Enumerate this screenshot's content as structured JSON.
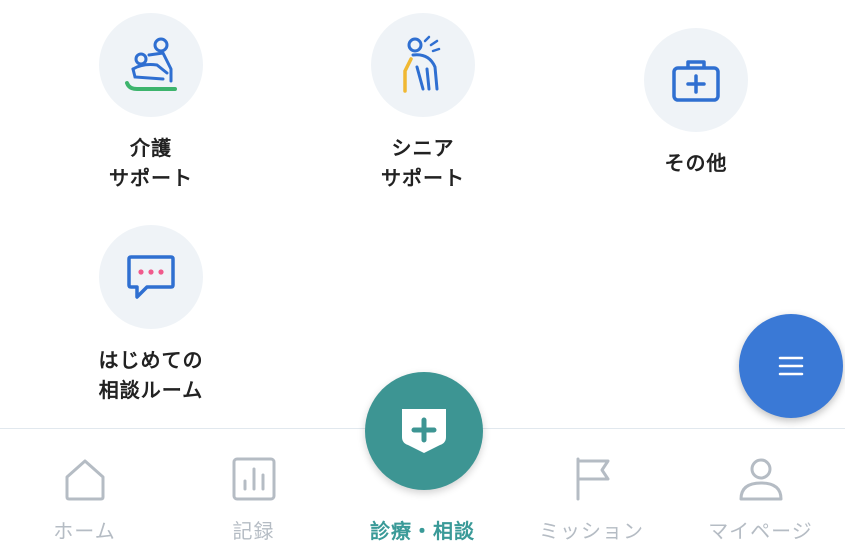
{
  "categories": [
    {
      "id": "care",
      "icon": "caregiving-icon",
      "label_lines": [
        "介護",
        "サポート"
      ]
    },
    {
      "id": "senior",
      "icon": "senior-walking-icon",
      "label_lines": [
        "シニア",
        "サポート"
      ]
    },
    {
      "id": "other",
      "icon": "medical-kit-icon",
      "label_lines": [
        "その他"
      ]
    },
    {
      "id": "consult",
      "icon": "chat-bubble-icon",
      "label_lines": [
        "はじめての",
        "相談ルーム"
      ]
    }
  ],
  "menu_button": {
    "icon": "menu-icon"
  },
  "tabbar": {
    "tabs": [
      {
        "id": "home",
        "label": "ホーム",
        "icon": "home-icon",
        "active": false
      },
      {
        "id": "record",
        "label": "記録",
        "icon": "chart-icon",
        "active": false
      },
      {
        "id": "consult",
        "label": "診療・相談",
        "icon": "medical-shield-icon",
        "active": true
      },
      {
        "id": "mission",
        "label": "ミッション",
        "icon": "flag-icon",
        "active": false
      },
      {
        "id": "mypage",
        "label": "マイページ",
        "icon": "person-icon",
        "active": false
      }
    ]
  },
  "colors": {
    "accent_teal": "#3d9593",
    "fab_blue": "#3a79d6",
    "icon_blue": "#2f6fd1",
    "icon_green": "#3db46d",
    "icon_yellow": "#f0b833",
    "tab_gray": "#b5bcc4"
  }
}
